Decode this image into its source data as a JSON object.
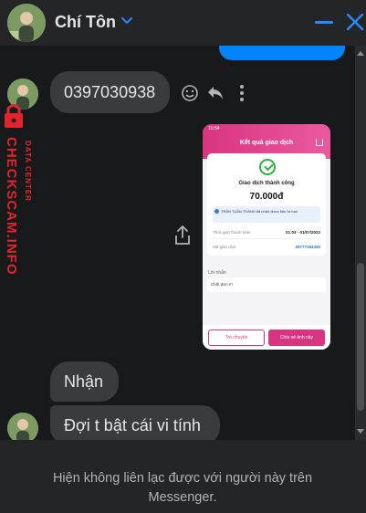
{
  "header": {
    "contact_name": "Chí Tôn"
  },
  "messages": {
    "phone_number": "0397030938",
    "reply_1": "Nhận",
    "reply_2": "Đợi t bật cái vi tính"
  },
  "receipt": {
    "status_bar": "10:54",
    "title": "Kết quả giao dịch",
    "success_text": "Giao dịch thành công",
    "amount": "70.000đ",
    "note": "TRẦN TUẤN THÀNH đã nhận được tiền từ bạn",
    "time_label": "Thời gian thanh toán",
    "time_value": "21:03 - 01/07/2022",
    "code_label": "Mã giao dịch",
    "code_value": "25777184320",
    "message_label": "Lời nhắn",
    "message_value": "Chốt đơn !!!",
    "btn_chat": "Trò chuyện",
    "btn_share": "Chia sẻ ảnh này",
    "accent": "#d9347f"
  },
  "watermark": {
    "line1": "DATA CENTER",
    "line2": "CHECKSCAM.INFO",
    "color": "#e0262c"
  },
  "footer": {
    "notice": "Hiện không liên lạc được với người này trên Messenger."
  },
  "colors": {
    "accent_blue": "#2d88ff",
    "bubble": "#3a3b3c"
  }
}
